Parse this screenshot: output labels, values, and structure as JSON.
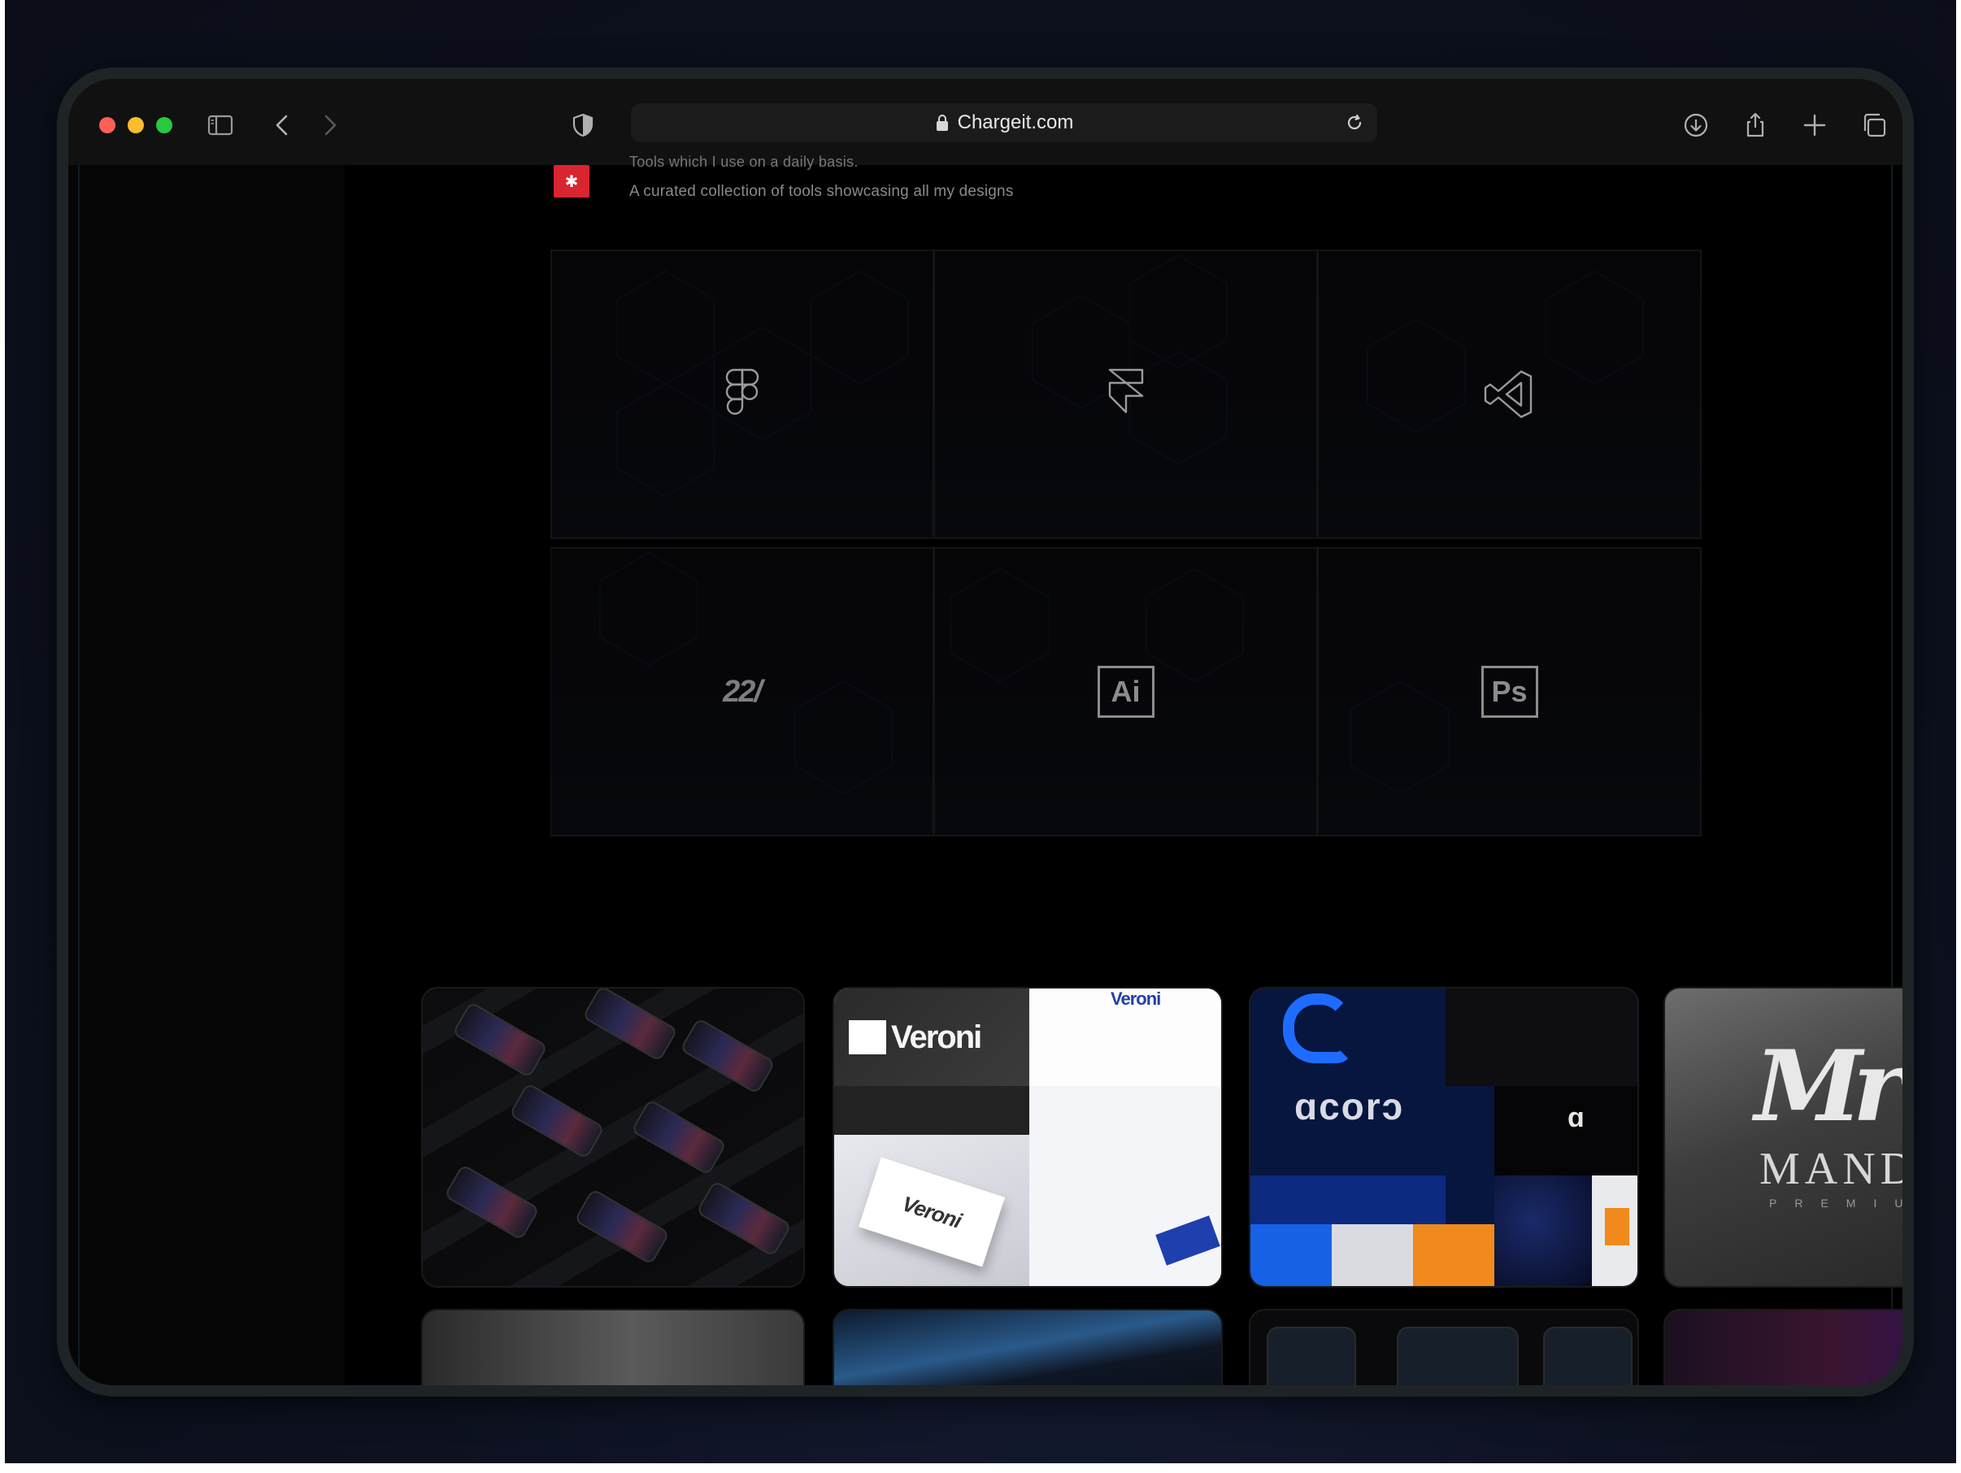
{
  "browser": {
    "url": "Chargeit.com",
    "icons": {
      "sidebar": "sidebar-icon",
      "back": "chevron-left-icon",
      "forward": "chevron-right-icon",
      "privacy": "shield-icon",
      "reload": "reload-icon",
      "download": "download-icon",
      "share": "share-icon",
      "new_tab": "plus-icon",
      "tabs": "tabs-overview-icon"
    }
  },
  "intro": {
    "heading": "Tools which I use on a daily basis.",
    "subheading": "A curated collection of tools showcasing all my designs"
  },
  "tools": [
    {
      "name": "figma-icon"
    },
    {
      "name": "framer-icon"
    },
    {
      "name": "vscode-icon"
    },
    {
      "name": "payments-icon",
      "text": "22/"
    },
    {
      "name": "illustrator-icon",
      "text": "Ai"
    },
    {
      "name": "photoshop-icon",
      "text": "Ps"
    }
  ],
  "gallery": {
    "veroni": {
      "logo": "Veroni",
      "small_logo": "Veroni",
      "card_text": "Veroni"
    },
    "acord": {
      "word": "ɑcorɔ",
      "mini": "ɑ"
    },
    "mandy": {
      "monogram": "Mr",
      "word": "MANDY",
      "sub": "PREMIUM"
    }
  },
  "colors": {
    "accent_red": "#d92530",
    "acord_blue": "#1e6cff",
    "veroni_blue": "#1f3fae"
  }
}
